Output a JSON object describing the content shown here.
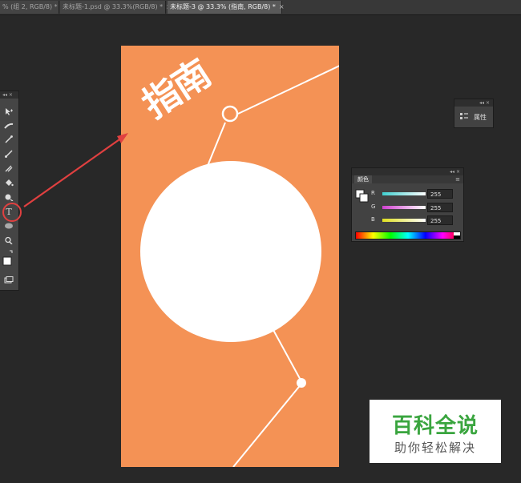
{
  "tabs": [
    {
      "label": "% (组 2, RGB/8) *",
      "active": false
    },
    {
      "label": "未标题-1.psd @ 33.3%(RGB/8) *",
      "active": false
    },
    {
      "label": "未标题-3 @ 33.3% (指南, RGB/8) *",
      "active": true
    }
  ],
  "tab_close": "×",
  "panel_controls": "◂◂ ×",
  "canvas": {
    "background_color": "#f49255",
    "title_text": "指南",
    "circle_color": "#ffffff"
  },
  "annotation": {
    "color": "#e04040"
  },
  "tools": {
    "icons": [
      "move-icon",
      "marquee-icon",
      "eyedropper-icon",
      "brush-icon",
      "stamp-icon",
      "paint-bucket-icon",
      "dodge-icon",
      "type-icon",
      "ellipse-icon",
      "zoom-icon",
      "foreground-background-icon",
      "screen-mode-icon"
    ],
    "type_glyph": "T"
  },
  "properties_panel": {
    "label": "属性"
  },
  "color_panel": {
    "tab_label": "颜色",
    "channels": [
      {
        "name": "R",
        "value": "255",
        "gradient": [
          "#3fd0d0",
          "#ffffff"
        ]
      },
      {
        "name": "G",
        "value": "255",
        "gradient": [
          "#d040d0",
          "#ffffff"
        ]
      },
      {
        "name": "B",
        "value": "255",
        "gradient": [
          "#e0e020",
          "#ffffff"
        ]
      }
    ]
  },
  "watermark": {
    "main": "百科全说",
    "sub": "助你轻松解决"
  }
}
